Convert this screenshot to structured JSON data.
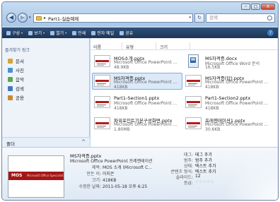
{
  "window": {
    "controls": {
      "minimize": "─",
      "maximize": "□",
      "close": "X"
    }
  },
  "nav": {
    "back": "◀",
    "forward": "▶",
    "dropdown": "▾"
  },
  "address": {
    "separator": "▸",
    "crumb": "Part1-실습예제",
    "dropdown": "▾"
  },
  "refresh": "↻",
  "search": {
    "placeholder": "검색"
  },
  "commandbar": {
    "items": [
      {
        "label": "구성",
        "icon": "organize-icon",
        "caret": "▾"
      },
      {
        "label": "보기",
        "icon": "views-icon",
        "caret": "▾"
      },
      {
        "label": "열기",
        "icon": "open-icon",
        "caret": "▾"
      },
      {
        "label": "인쇄",
        "icon": "print-icon"
      },
      {
        "label": "전자 메일",
        "icon": "email-icon"
      },
      {
        "label": "공유",
        "icon": "share-icon"
      }
    ],
    "help": "?"
  },
  "navpane": {
    "header": "즐겨찾기 링크",
    "items": [
      {
        "label": "문서",
        "color": "#d4a53a"
      },
      {
        "label": "사진",
        "color": "#4a8fd4"
      },
      {
        "label": "음악",
        "color": "#5aa84a"
      },
      {
        "label": "검색",
        "color": "#3d78c4"
      },
      {
        "label": "공용",
        "color": "#c98b2d"
      }
    ],
    "folders_label": "폴더",
    "folders_caret": "^"
  },
  "columns": {
    "name": "이름",
    "type": "유형",
    "size": "크기"
  },
  "files": [
    {
      "name": "MOS소개.pptx",
      "type": "Microsoft Office PowerPoint ...",
      "size": "48.9KB",
      "kind": "ppt"
    },
    {
      "name": "MS자격증.docx",
      "type": "Microsoft Office Word 문서",
      "size": "16.5KB",
      "kind": "doc"
    },
    {
      "name": "MS자격증.pptx",
      "type": "Microsoft Office PowerPoint ...",
      "size": "418KB",
      "kind": "ppt"
    },
    {
      "name": "MS자격증(답).pptx",
      "type": "Microsoft Office PowerPoint ...",
      "size": "418KB",
      "kind": "ppt"
    },
    {
      "name": "Part1-Section1.pptx",
      "type": "Microsoft Office PowerPoint ...",
      "size": "418KB",
      "kind": "ppt"
    },
    {
      "name": "Part1-Section2.pptx",
      "type": "Microsoft Office PowerPoint ...",
      "size": "418KB",
      "kind": "ppt"
    },
    {
      "name": "파워포인트기본구성화면.pptx",
      "type": "Microsoft Office PowerPoint ...",
      "size": "1.80MB",
      "kind": "ppt"
    },
    {
      "name": "프레젠테이션1.pptx",
      "type": "Microsoft Office PowerPoint ...",
      "size": "30.6KB",
      "kind": "ppt"
    }
  ],
  "details": {
    "preview_logo": "MOS",
    "preview_sub": "Microsoft Office Specialist",
    "filename": "MS자격증.pptx",
    "filetype": "Microsoft Office PowerPoint 프레젠테이션",
    "left": [
      {
        "key": "제목:",
        "value": "MOS 소개 (Microsoft C..."
      },
      {
        "key": "만든 이:",
        "value": "이지은"
      },
      {
        "key": "크기:",
        "value": "418KB"
      },
      {
        "key": "수정한 날짜:",
        "value": "2011-05-18 오후 6:25"
      }
    ],
    "right": [
      {
        "key": "태그:",
        "value": "태그 추가"
      },
      {
        "key": "범주:",
        "value": "범주 추가"
      },
      {
        "key": "상태:",
        "value": "텍스트 추가"
      },
      {
        "key": "콘텐츠 형식:",
        "value": "텍스트 추가"
      },
      {
        "key": "슬라이드:",
        "value": "12"
      }
    ],
    "rating_label": "등급:",
    "stars": "☆☆☆☆☆"
  }
}
